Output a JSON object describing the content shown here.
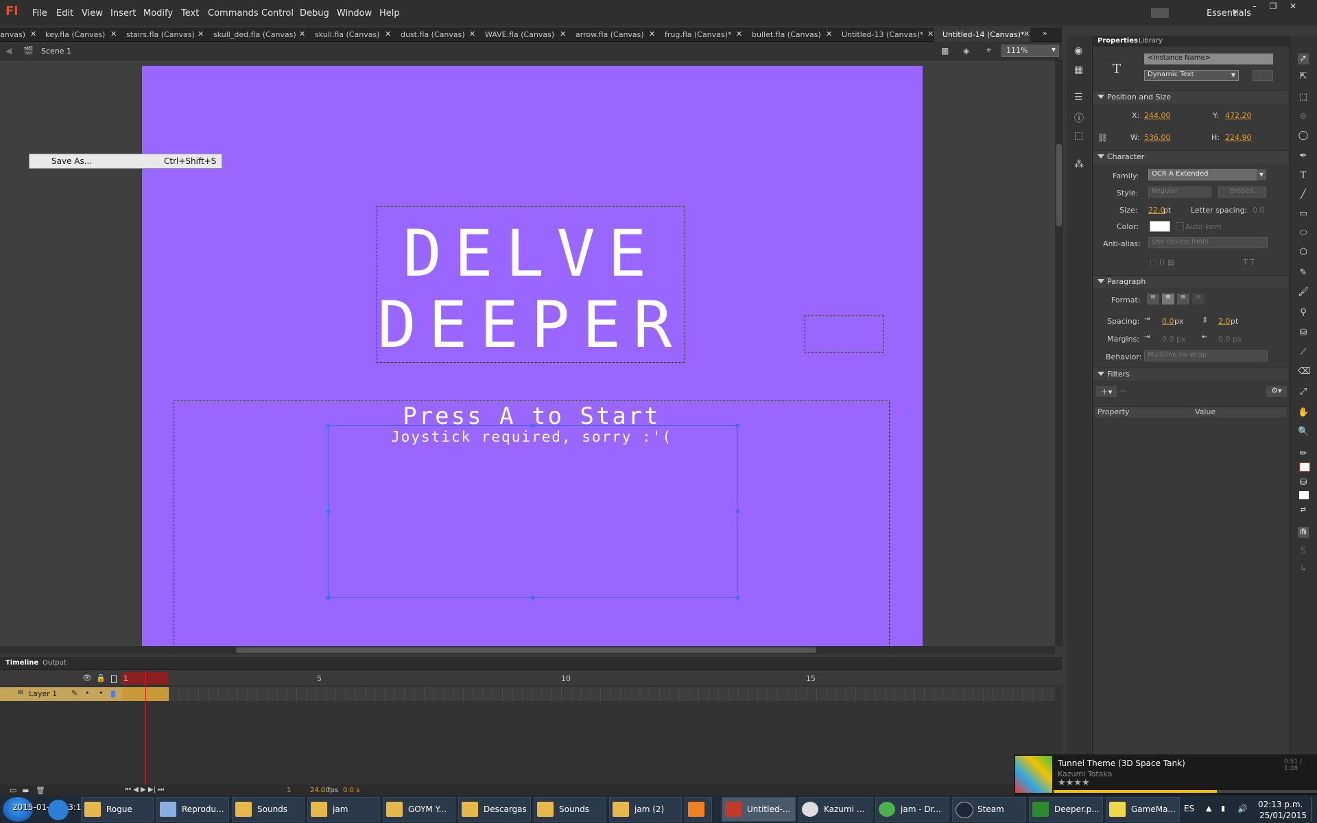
{
  "app": {
    "logo": "Fl",
    "menu": [
      "File",
      "Edit",
      "View",
      "Insert",
      "Modify",
      "Text",
      "Commands",
      "Control",
      "Debug",
      "Window",
      "Help"
    ],
    "workspace": "Essentials",
    "tabs": [
      "anvas)",
      "key.fla (Canvas)",
      "stairs.fla (Canvas)",
      "skull_ded.fla (Canvas)",
      "skull.fla (Canvas)",
      "dust.fla (Canvas)",
      "WAVE.fla (Canvas)",
      "arrow.fla (Canvas)",
      "frug.fla (Canvas)*",
      "bullet.fla (Canvas)",
      "Untitled-13 (Canvas)*",
      "Untitled-14 (Canvas)*"
    ],
    "active_tab_index": 11,
    "scene": "Scene 1",
    "zoom": "111%"
  },
  "context_menu": {
    "label": "Save As...",
    "shortcut": "Ctrl+Shift+S"
  },
  "stage": {
    "title_line1": "DELVE",
    "title_line2": "DEEPER",
    "press_start": "Press A to Start",
    "joystick_note": "Joystick required, sorry :'("
  },
  "timeline": {
    "tabs": [
      "Timeline",
      "Output"
    ],
    "layer_name": "Layer 1",
    "frame_markers": [
      "1",
      "5",
      "10",
      "15"
    ],
    "current_frame": "1",
    "fps": "24.00",
    "fps_unit": "fps",
    "time": "0.0 s"
  },
  "properties": {
    "tabs": [
      "Properties",
      "Library"
    ],
    "instance_name_placeholder": "<Instance Name>",
    "text_type": "Dynamic Text",
    "position_size": {
      "header": "Position and Size",
      "x_label": "X:",
      "x": "244.00",
      "y_label": "Y:",
      "y": "472.20",
      "w_label": "W:",
      "w": "536.00",
      "h_label": "H:",
      "h": "224.90"
    },
    "character": {
      "header": "Character",
      "family_label": "Family:",
      "family": "OCR A Extended",
      "style_label": "Style:",
      "style": "Regular",
      "embed": "Embed...",
      "size_label": "Size:",
      "size": "22.0",
      "size_unit": "pt",
      "letter_spacing_label": "Letter spacing:",
      "letter_spacing": "0.0",
      "color_label": "Color:",
      "color": "#ffffff",
      "auto_kern": "Auto kern",
      "anti_alias_label": "Anti-alias:",
      "anti_alias": "Use device fonts"
    },
    "paragraph": {
      "header": "Paragraph",
      "format_label": "Format:",
      "spacing_label": "Spacing:",
      "spacing_indent": "0.0",
      "spacing_indent_unit": "px",
      "spacing_line": "2.0",
      "spacing_line_unit": "pt",
      "margins_label": "Margins:",
      "margin_left": "0.0 px",
      "margin_right": "0.0 px",
      "behavior_label": "Behavior:",
      "behavior": "Multiline no wrap"
    },
    "filters": {
      "header": "Filters",
      "col_property": "Property",
      "col_value": "Value"
    }
  },
  "music": {
    "title": "Tunnel Theme (3D Space Tank)",
    "artist": "Kazumi Totaka",
    "time": "0:51 / 1:28",
    "stars": "★★★★",
    "progress": 0.62
  },
  "taskbar": {
    "items": [
      "Rogue",
      "Reprodu...",
      "Sounds",
      "jam",
      "GOYM Y...",
      "Descargas",
      "Sounds",
      "jam (2)",
      "",
      "Untitled-...",
      "Kazumi ...",
      "jam - Dr...",
      "Steam",
      "Deeper.p...",
      "GameMa..."
    ],
    "overlay_text": "2015-01-25 13:17:04",
    "lang": "ES",
    "clock_time": "02:13 p.m.",
    "clock_date": "25/01/2015"
  },
  "colors": {
    "stage": "#9966ff",
    "accent": "#e0a030",
    "selection": "#3b6dff",
    "frame": "#c99a37"
  }
}
